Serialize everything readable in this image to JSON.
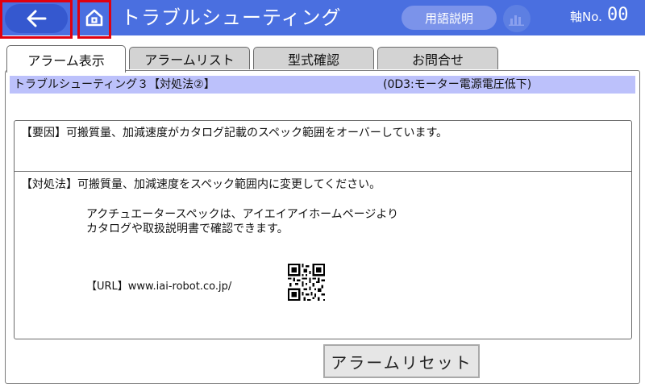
{
  "header": {
    "title": "トラブルシューティング",
    "glossary_label": "用語説明",
    "axis_label": "軸No.",
    "axis_number": "00",
    "accent_color": "#4a6fe0",
    "icons": {
      "back": "arrow-left-icon",
      "home": "home-icon",
      "chart": "bar-chart-icon"
    }
  },
  "tabs": [
    {
      "label": "アラーム表示",
      "active": true
    },
    {
      "label": "アラームリスト",
      "active": false
    },
    {
      "label": "型式確認",
      "active": false
    },
    {
      "label": "お問合せ",
      "active": false
    }
  ],
  "main": {
    "subtitle": "トラブルシューティング３【対処法②】",
    "alarm_code": "(0D3:モーター電源電圧低下)",
    "cause": "【要因】可搬質量、加減速度がカタログ記載のスペック範囲をオーバーしています。",
    "remedy": "【対処法】可搬質量、加減速度をスペック範囲内に変更してください。",
    "spec_line1": "アクチュエータースペックは、アイエイアイホームページより",
    "spec_line2": "カタログや取扱説明書で確認できます。",
    "url_text": "【URL】www.iai-robot.co.jp/",
    "reset_label": "アラームリセット"
  }
}
